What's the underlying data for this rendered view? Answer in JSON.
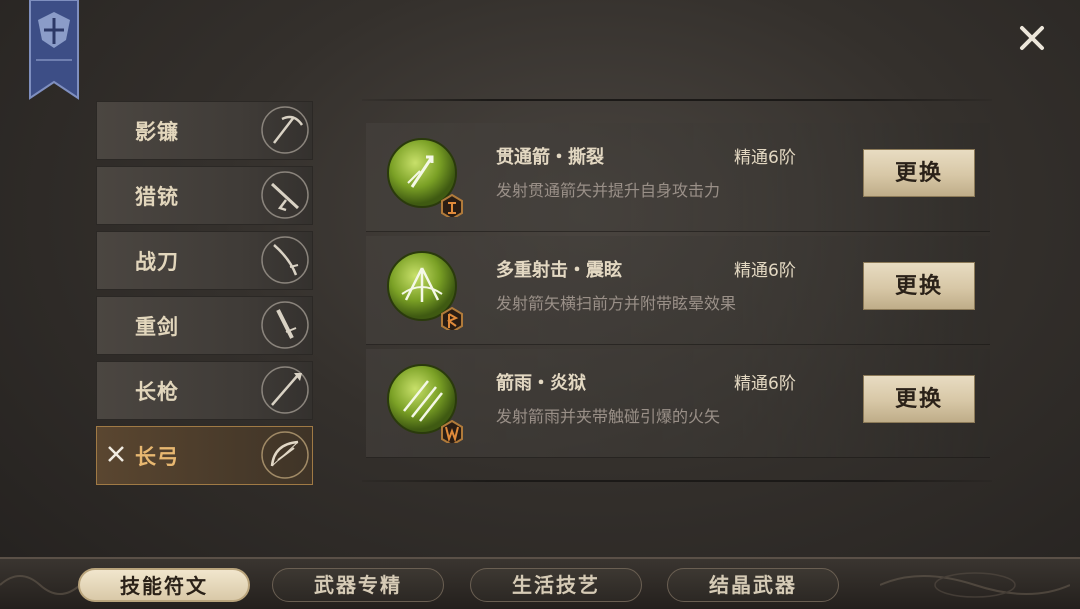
{
  "header": {
    "close_icon": "close-icon",
    "banner_icon": "guild-banner-icon"
  },
  "weapons": [
    {
      "label": "影镰",
      "icon": "scythe-icon",
      "selected": false
    },
    {
      "label": "猎铳",
      "icon": "musket-icon",
      "selected": false
    },
    {
      "label": "战刀",
      "icon": "saber-icon",
      "selected": false
    },
    {
      "label": "重剑",
      "icon": "greatsword-icon",
      "selected": false
    },
    {
      "label": "长枪",
      "icon": "spear-icon",
      "selected": false
    },
    {
      "label": "长弓",
      "icon": "longbow-icon",
      "selected": true
    }
  ],
  "skills": [
    {
      "name": "贯通箭・撕裂",
      "level": "精通6阶",
      "desc": "发射贯通箭矢并提升自身攻击力",
      "button": "更换",
      "icon": "piercing-arrow-icon",
      "rune": "rune-icon"
    },
    {
      "name": "多重射击・震眩",
      "level": "精通6阶",
      "desc": "发射箭矢横扫前方并附带眩晕效果",
      "button": "更换",
      "icon": "multishot-icon",
      "rune": "rune-icon"
    },
    {
      "name": "箭雨・炎狱",
      "level": "精通6阶",
      "desc": "发射箭雨并夹带触碰引爆的火矢",
      "button": "更换",
      "icon": "arrow-rain-icon",
      "rune": "rune-icon"
    }
  ],
  "tabs": [
    {
      "label": "技能符文",
      "active": true
    },
    {
      "label": "武器专精",
      "active": false
    },
    {
      "label": "生活技艺",
      "active": false
    },
    {
      "label": "结晶武器",
      "active": false
    }
  ],
  "colors": {
    "accent": "#e8b871",
    "skill_orb": "#8bb02c",
    "button_bg": "#d7c7a6"
  }
}
